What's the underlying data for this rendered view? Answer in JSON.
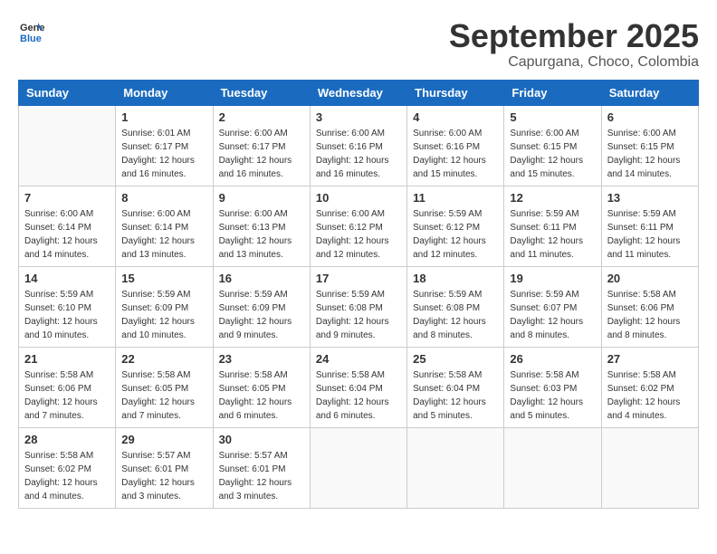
{
  "header": {
    "logo_general": "General",
    "logo_blue": "Blue",
    "month_title": "September 2025",
    "subtitle": "Capurgana, Choco, Colombia"
  },
  "weekdays": [
    "Sunday",
    "Monday",
    "Tuesday",
    "Wednesday",
    "Thursday",
    "Friday",
    "Saturday"
  ],
  "weeks": [
    [
      {
        "day": "",
        "info": ""
      },
      {
        "day": "1",
        "info": "Sunrise: 6:01 AM\nSunset: 6:17 PM\nDaylight: 12 hours\nand 16 minutes."
      },
      {
        "day": "2",
        "info": "Sunrise: 6:00 AM\nSunset: 6:17 PM\nDaylight: 12 hours\nand 16 minutes."
      },
      {
        "day": "3",
        "info": "Sunrise: 6:00 AM\nSunset: 6:16 PM\nDaylight: 12 hours\nand 16 minutes."
      },
      {
        "day": "4",
        "info": "Sunrise: 6:00 AM\nSunset: 6:16 PM\nDaylight: 12 hours\nand 15 minutes."
      },
      {
        "day": "5",
        "info": "Sunrise: 6:00 AM\nSunset: 6:15 PM\nDaylight: 12 hours\nand 15 minutes."
      },
      {
        "day": "6",
        "info": "Sunrise: 6:00 AM\nSunset: 6:15 PM\nDaylight: 12 hours\nand 14 minutes."
      }
    ],
    [
      {
        "day": "7",
        "info": "Sunrise: 6:00 AM\nSunset: 6:14 PM\nDaylight: 12 hours\nand 14 minutes."
      },
      {
        "day": "8",
        "info": "Sunrise: 6:00 AM\nSunset: 6:14 PM\nDaylight: 12 hours\nand 13 minutes."
      },
      {
        "day": "9",
        "info": "Sunrise: 6:00 AM\nSunset: 6:13 PM\nDaylight: 12 hours\nand 13 minutes."
      },
      {
        "day": "10",
        "info": "Sunrise: 6:00 AM\nSunset: 6:12 PM\nDaylight: 12 hours\nand 12 minutes."
      },
      {
        "day": "11",
        "info": "Sunrise: 5:59 AM\nSunset: 6:12 PM\nDaylight: 12 hours\nand 12 minutes."
      },
      {
        "day": "12",
        "info": "Sunrise: 5:59 AM\nSunset: 6:11 PM\nDaylight: 12 hours\nand 11 minutes."
      },
      {
        "day": "13",
        "info": "Sunrise: 5:59 AM\nSunset: 6:11 PM\nDaylight: 12 hours\nand 11 minutes."
      }
    ],
    [
      {
        "day": "14",
        "info": "Sunrise: 5:59 AM\nSunset: 6:10 PM\nDaylight: 12 hours\nand 10 minutes."
      },
      {
        "day": "15",
        "info": "Sunrise: 5:59 AM\nSunset: 6:09 PM\nDaylight: 12 hours\nand 10 minutes."
      },
      {
        "day": "16",
        "info": "Sunrise: 5:59 AM\nSunset: 6:09 PM\nDaylight: 12 hours\nand 9 minutes."
      },
      {
        "day": "17",
        "info": "Sunrise: 5:59 AM\nSunset: 6:08 PM\nDaylight: 12 hours\nand 9 minutes."
      },
      {
        "day": "18",
        "info": "Sunrise: 5:59 AM\nSunset: 6:08 PM\nDaylight: 12 hours\nand 8 minutes."
      },
      {
        "day": "19",
        "info": "Sunrise: 5:59 AM\nSunset: 6:07 PM\nDaylight: 12 hours\nand 8 minutes."
      },
      {
        "day": "20",
        "info": "Sunrise: 5:58 AM\nSunset: 6:06 PM\nDaylight: 12 hours\nand 8 minutes."
      }
    ],
    [
      {
        "day": "21",
        "info": "Sunrise: 5:58 AM\nSunset: 6:06 PM\nDaylight: 12 hours\nand 7 minutes."
      },
      {
        "day": "22",
        "info": "Sunrise: 5:58 AM\nSunset: 6:05 PM\nDaylight: 12 hours\nand 7 minutes."
      },
      {
        "day": "23",
        "info": "Sunrise: 5:58 AM\nSunset: 6:05 PM\nDaylight: 12 hours\nand 6 minutes."
      },
      {
        "day": "24",
        "info": "Sunrise: 5:58 AM\nSunset: 6:04 PM\nDaylight: 12 hours\nand 6 minutes."
      },
      {
        "day": "25",
        "info": "Sunrise: 5:58 AM\nSunset: 6:04 PM\nDaylight: 12 hours\nand 5 minutes."
      },
      {
        "day": "26",
        "info": "Sunrise: 5:58 AM\nSunset: 6:03 PM\nDaylight: 12 hours\nand 5 minutes."
      },
      {
        "day": "27",
        "info": "Sunrise: 5:58 AM\nSunset: 6:02 PM\nDaylight: 12 hours\nand 4 minutes."
      }
    ],
    [
      {
        "day": "28",
        "info": "Sunrise: 5:58 AM\nSunset: 6:02 PM\nDaylight: 12 hours\nand 4 minutes."
      },
      {
        "day": "29",
        "info": "Sunrise: 5:57 AM\nSunset: 6:01 PM\nDaylight: 12 hours\nand 3 minutes."
      },
      {
        "day": "30",
        "info": "Sunrise: 5:57 AM\nSunset: 6:01 PM\nDaylight: 12 hours\nand 3 minutes."
      },
      {
        "day": "",
        "info": ""
      },
      {
        "day": "",
        "info": ""
      },
      {
        "day": "",
        "info": ""
      },
      {
        "day": "",
        "info": ""
      }
    ]
  ]
}
